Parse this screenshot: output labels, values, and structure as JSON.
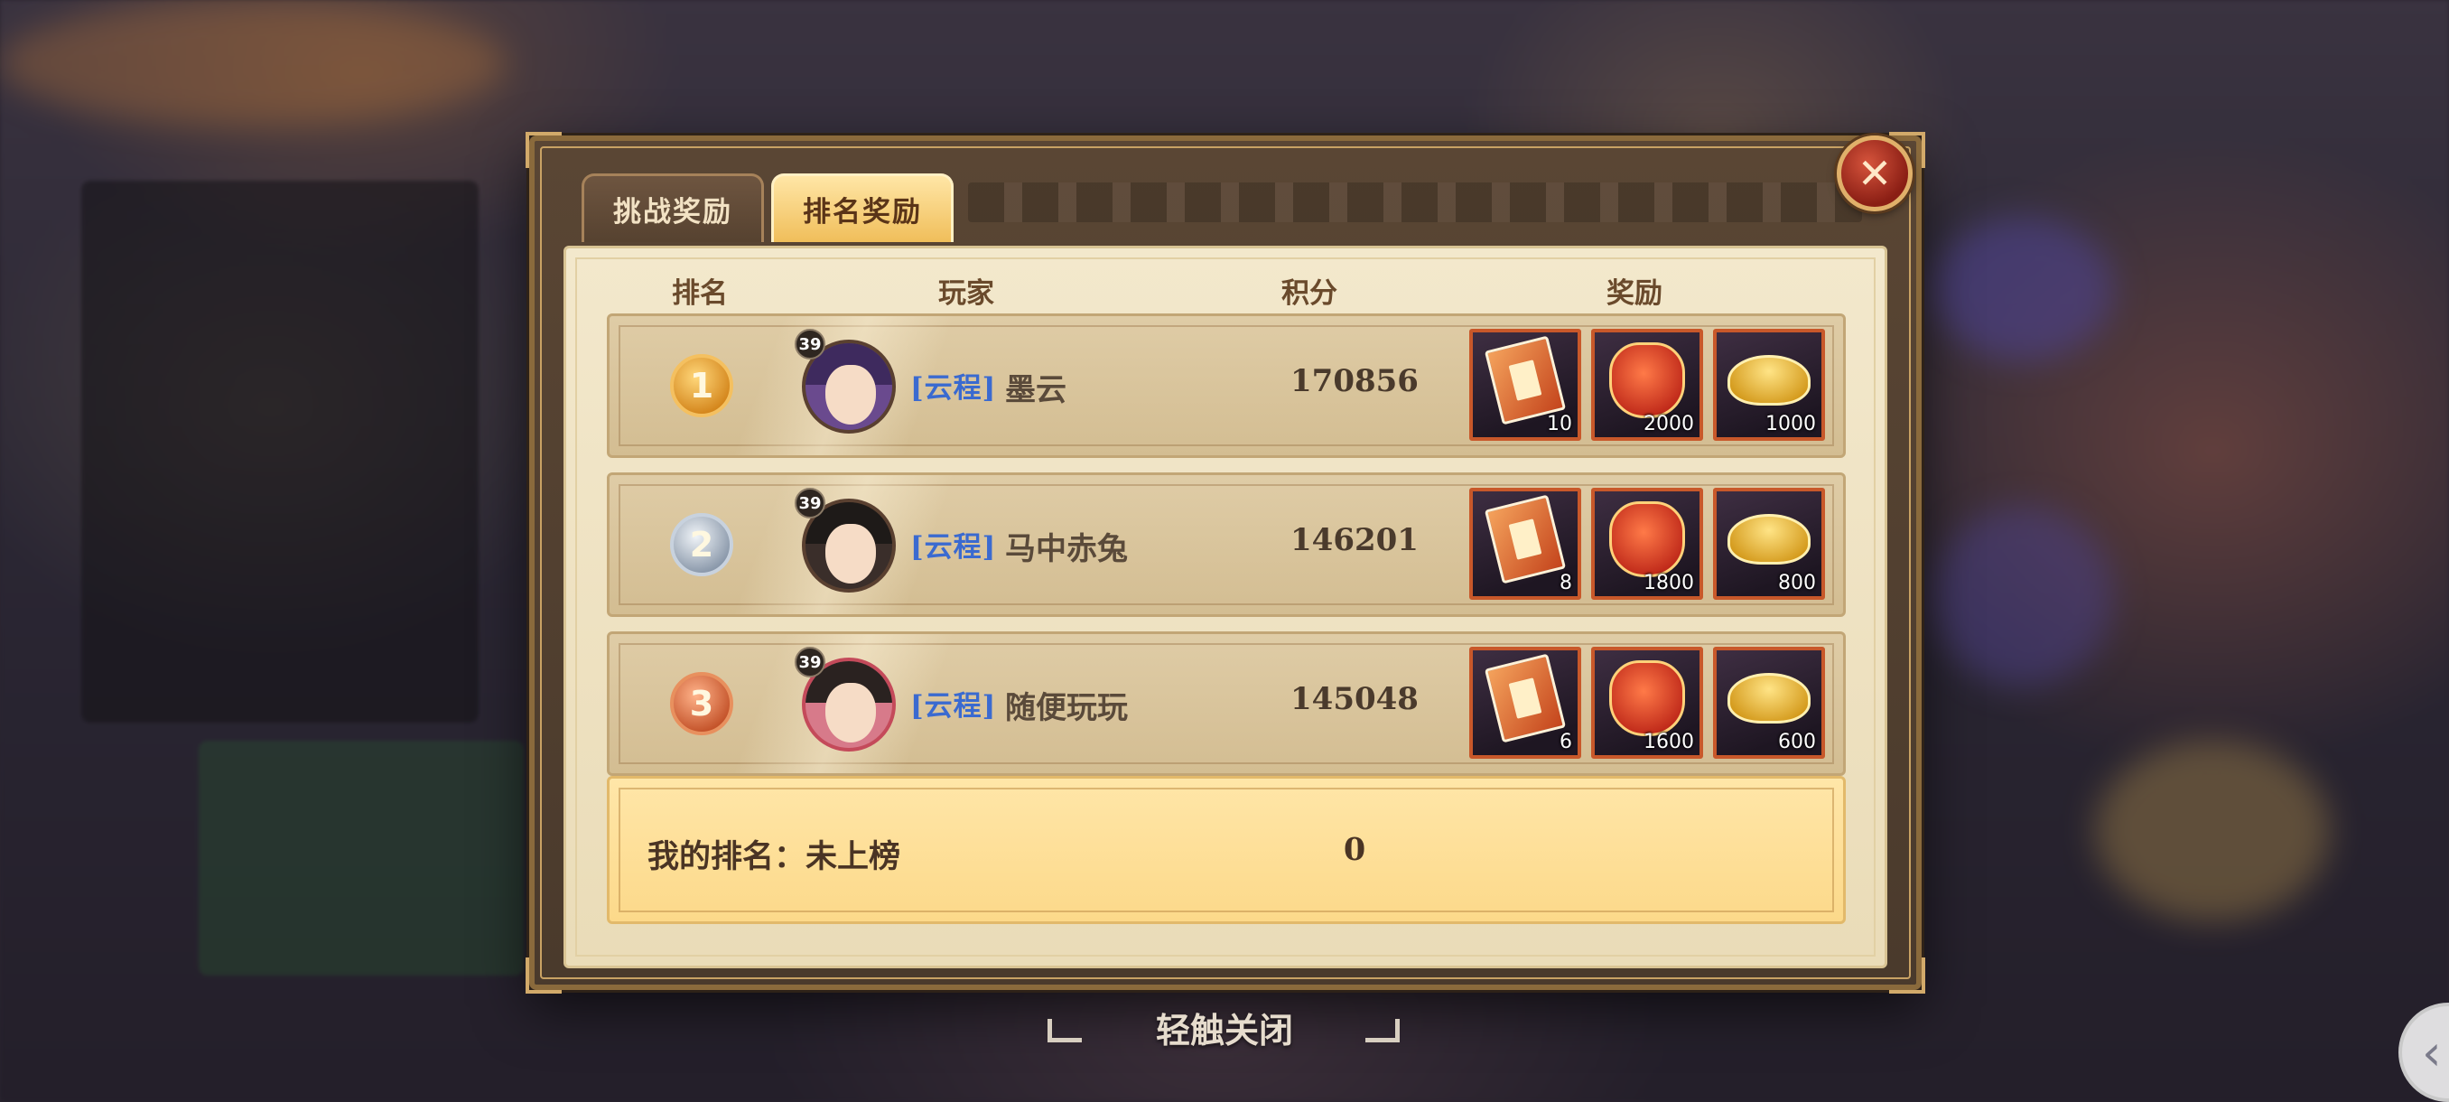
{
  "tabs": {
    "challenge": "挑战奖励",
    "ranking": "排名奖励"
  },
  "close_icon": "✕",
  "headers": {
    "rank": "排名",
    "player": "玩家",
    "score": "积分",
    "reward": "奖励"
  },
  "rows": [
    {
      "rank": "1",
      "medal": "gold",
      "level": "39",
      "guild": "[云程]",
      "name": "墨云",
      "score": "170856",
      "rewards": [
        {
          "icon": "book-icon",
          "qty": "10"
        },
        {
          "icon": "red-pouch-icon",
          "qty": "2000"
        },
        {
          "icon": "gold-ingot-icon",
          "qty": "1000"
        }
      ]
    },
    {
      "rank": "2",
      "medal": "silver",
      "level": "39",
      "guild": "[云程]",
      "name": "马中赤兔",
      "score": "146201",
      "rewards": [
        {
          "icon": "book-icon",
          "qty": "8"
        },
        {
          "icon": "red-pouch-icon",
          "qty": "1800"
        },
        {
          "icon": "gold-ingot-icon",
          "qty": "800"
        }
      ]
    },
    {
      "rank": "3",
      "medal": "bronze",
      "level": "39",
      "guild": "[云程]",
      "name": "随便玩玩",
      "score": "145048",
      "rewards": [
        {
          "icon": "book-icon",
          "qty": "6"
        },
        {
          "icon": "red-pouch-icon",
          "qty": "1600"
        },
        {
          "icon": "gold-ingot-icon",
          "qty": "600"
        }
      ]
    }
  ],
  "my_rank": {
    "label": "我的排名：未上榜",
    "score": "0"
  },
  "tap_to_close": "轻触关闭",
  "side_arrow": "‹",
  "colors": {
    "active_tab": "#f0be5a",
    "guild_tag": "#3a6ad0",
    "reward_border": "#c8582a"
  }
}
